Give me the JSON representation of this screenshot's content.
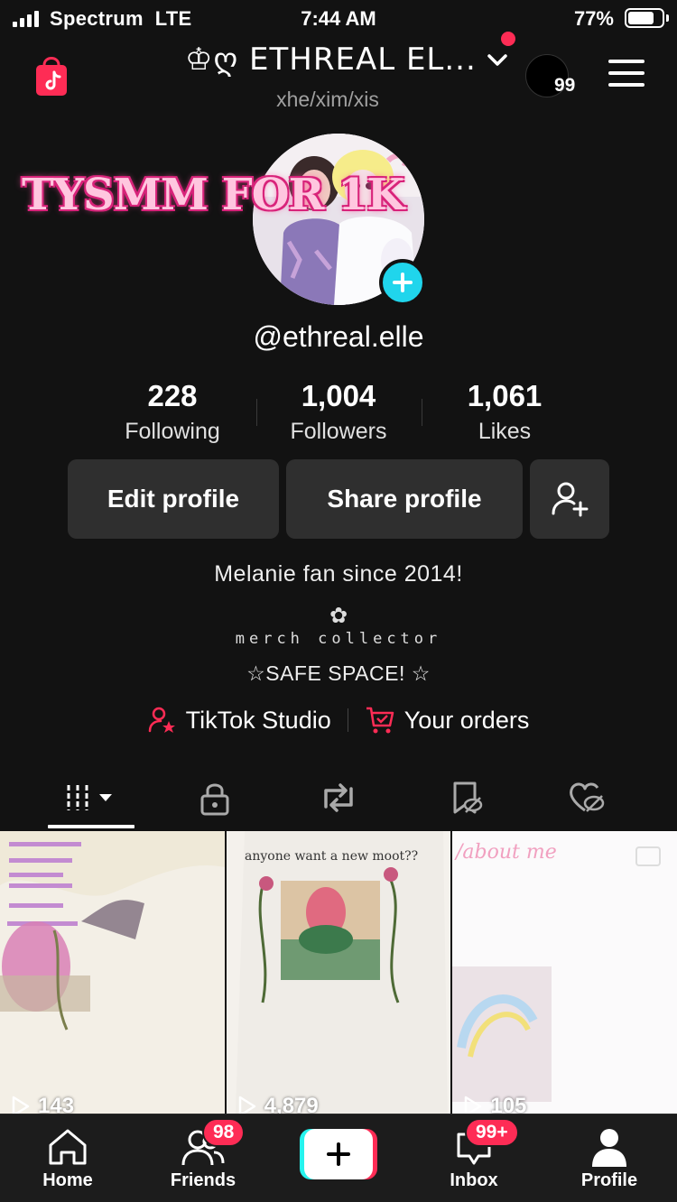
{
  "status_bar": {
    "carrier": "Spectrum",
    "network": "LTE",
    "time": "7:44 AM",
    "battery": "77%",
    "battery_level": 0.77
  },
  "header": {
    "title": "♔ღ ETHREAL EL...",
    "pronouns": "xhe/xim/xis",
    "mini_badge_count": "99"
  },
  "profile": {
    "overlay_text": "TYSMM FOR 1K",
    "username": "@ethreal.elle",
    "stats": [
      {
        "value": "228",
        "label": "Following"
      },
      {
        "value": "1,004",
        "label": "Followers"
      },
      {
        "value": "1,061",
        "label": "Likes"
      }
    ],
    "buttons": {
      "edit": "Edit profile",
      "share": "Share profile"
    },
    "bio": {
      "line1": "Melanie fan since 2014!",
      "flower": "✿",
      "line2": "merch collector",
      "line3": "☆SAFE SPACE! ☆"
    },
    "links": {
      "studio": "TikTok Studio",
      "orders": "Your orders"
    }
  },
  "tabs": [
    "videos",
    "private",
    "reposts",
    "favorites",
    "liked"
  ],
  "grid": [
    {
      "views": "143"
    },
    {
      "views": "4,879",
      "caption": "anyone want a new moot??"
    },
    {
      "views": "105",
      "caption": "/about me"
    }
  ],
  "bottom_nav": {
    "home": "Home",
    "friends": "Friends",
    "friends_badge": "98",
    "inbox": "Inbox",
    "inbox_badge": "99+",
    "profile": "Profile"
  },
  "colors": {
    "background": "#121212",
    "accent_red": "#fe2c55",
    "accent_cyan": "#20d5ec",
    "button_bg": "#2f2f2f"
  }
}
